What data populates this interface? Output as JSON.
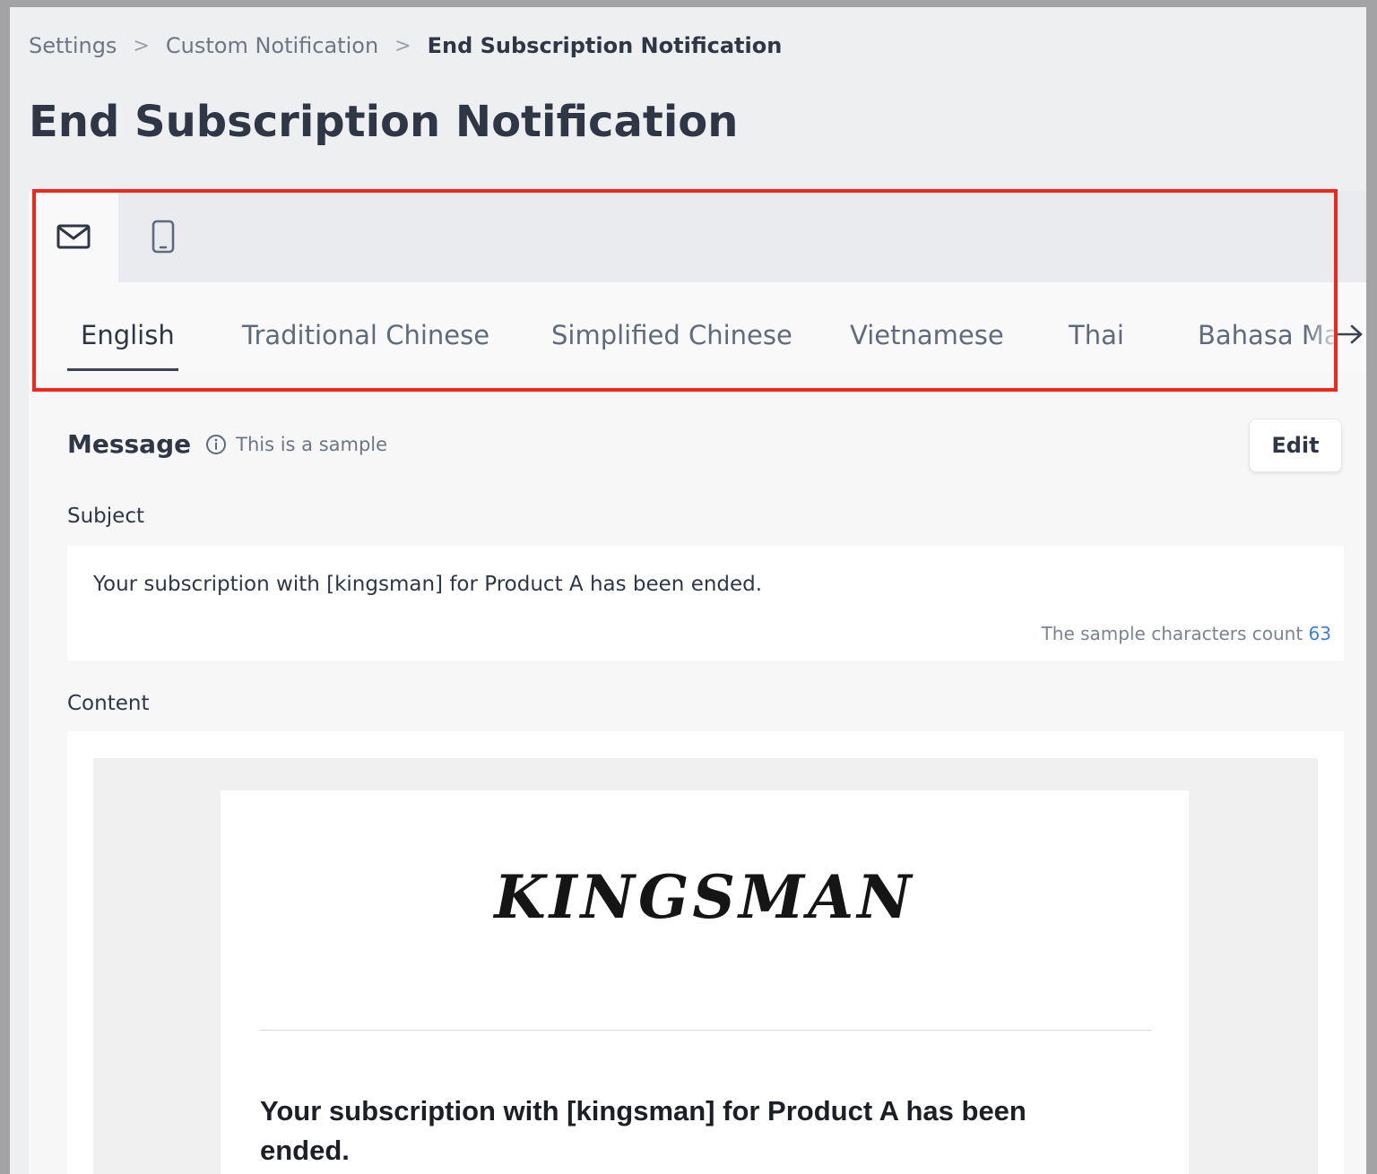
{
  "breadcrumb": {
    "items": [
      "Settings",
      "Custom Notification",
      "End Subscription Notification"
    ],
    "separator": ">"
  },
  "page": {
    "title": "End Subscription Notification"
  },
  "channel_tabs": [
    {
      "icon": "email-icon",
      "active": true
    },
    {
      "icon": "mobile-phone-icon",
      "active": false
    }
  ],
  "language_tabs": {
    "items": [
      "English",
      "Traditional Chinese",
      "Simplified Chinese",
      "Vietnamese",
      "Thai",
      "Bahasa Ma"
    ],
    "active": "English",
    "scroll_icon": "arrow-right-icon"
  },
  "message": {
    "label": "Message",
    "info_icon": "info-icon",
    "info_text": "This is a sample",
    "edit_label": "Edit"
  },
  "subject": {
    "label": "Subject",
    "text": "Your subscription with [kingsman] for Product A has been ended.",
    "count_label": "The sample characters count",
    "count_value": "63"
  },
  "content": {
    "label": "Content",
    "brand": "KINGSMAN",
    "heading": "Your subscription with [kingsman] for Product A has been ended."
  },
  "colors": {
    "highlight": "#f2261a",
    "accent": "#3d7fe0",
    "text": "#2f3747"
  }
}
